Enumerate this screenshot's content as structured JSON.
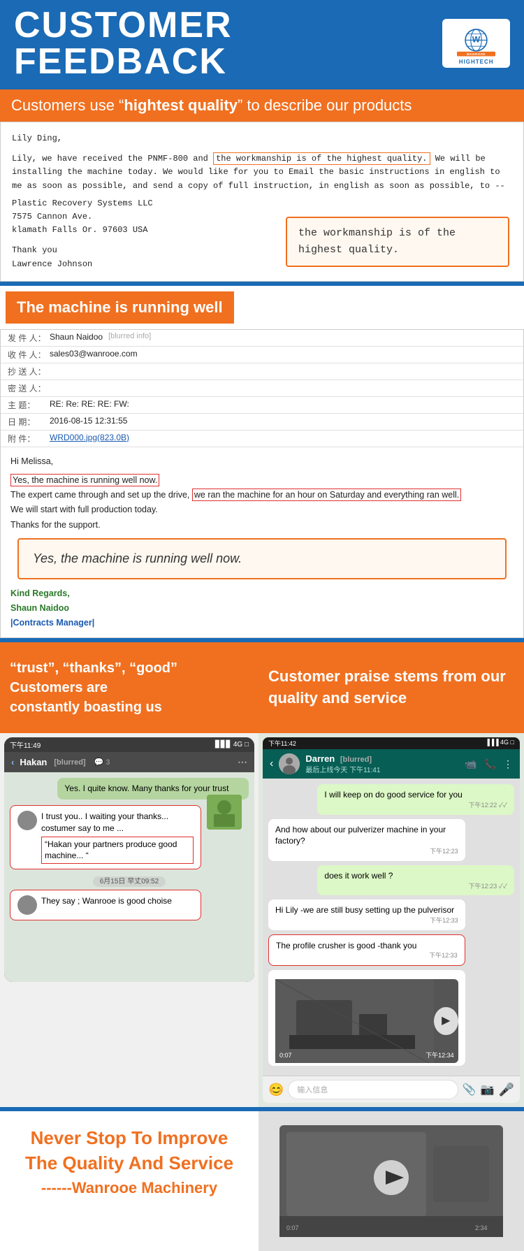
{
  "header": {
    "title": "CUSTOMER FEEDBACK",
    "logo_text_line1": "WANROOE",
    "logo_text_line2": "HIGHTECH"
  },
  "section1": {
    "banner": "Customers use “hightest quality” to describe our products",
    "banner_bold": "hightest quality",
    "email": {
      "greeting": "Lily Ding,",
      "body": "Lily, we have received the PNMF-800 and",
      "highlight": "the workmanship is of the highest quality.",
      "body2": "We will be installing the machine today.   We would like for you to Email the basic instructions in english to me as soon as possible, and send a copy of full instruction, in english as soon as possible, to --",
      "company": "Plastic Recovery Systems LLC",
      "address1": "7575 Cannon Ave.",
      "address2": "klamath Falls Or. 97603 USA",
      "closing": "Thank you",
      "signature": "Lawrence Johnson",
      "callout": "the workmanship is of the highest quality."
    }
  },
  "section2": {
    "banner": "The machine is running well",
    "email": {
      "from_label": "发 件 人：",
      "from_value": "Shaun Naidoo",
      "to_label": "收 件 人：",
      "to_value": "sales03@wanrooe.com",
      "cc_label": "抄 送 人：",
      "cc_value": "",
      "bcc_label": "密 送 人：",
      "bcc_value": "",
      "subject_label": "主    题：",
      "subject_value": "RE: Re: RE: RE: FW:",
      "date_label": "日    期：",
      "date_value": "2016-08-15 12:31:55",
      "attach_label": "附    件：",
      "attach_value": "WRD000.jpg(823.0B)",
      "greeting": "Hi Melissa,",
      "highlight1": "Yes, the machine is running well now.",
      "body1": "The expert came through and set up the drive,",
      "highlight2": "we ran the machine for an hour on Saturday and everything ran well.",
      "body2": "We will start with full production today.",
      "body3": "Thanks for the support.",
      "sign1": "Kind Regards,",
      "sign2": "Shaun Naidoo",
      "sign3": "|Contracts Manager|",
      "callout": "Yes, the machine is running well now."
    }
  },
  "section3": {
    "left_banner": "“trust”, “thanks”, “good”\nCustomers are constantly boasting us",
    "right_banner": "Customer praise stems from our quality and service",
    "left_chat": {
      "time": "下午11:49",
      "signal": "▐▐▐ 4G",
      "contact": "Hakan",
      "msg1_sent": "Yes. I quite know. Many thanks for your trust",
      "msg2_recv_prefix": "I trust you.. I waiting your thanks... costumer say to me ...",
      "msg2_recv_highlight": "“Hakan your partners produce good machine... “",
      "msg_date": "6月15日 早丈09:52",
      "msg3_recv_highlight": "They say ; Wanrooe is good choise"
    },
    "right_chat": {
      "time": "下午11:42",
      "signal": "▐▐▐ 4G",
      "contact": "Darren",
      "last_seen": "最后上线今天 下午11:41",
      "msg1_sent": "I will keep on do good service for you",
      "msg1_time": "下午12:22",
      "msg2_recv": "And how about our pulverizer machine in your factory?",
      "msg2_time": "下午12:23",
      "msg3_sent": "does it work well ?",
      "msg3_time": "下午12:23",
      "msg4_recv": "Hi Lily -we are still busy setting up the pulverisor",
      "msg4_time": "下午12:33",
      "msg5_recv_highlight": "The profile crusher is good -thank you",
      "msg5_time": "下午12:33",
      "video_time": "0:07",
      "video_msg_time": "下午12:34",
      "input_placeholder": "输入信息"
    }
  },
  "section4": {
    "title_line1": "Never Stop To Improve",
    "title_line2": "The Quality And Service",
    "title_line3": "------Wanrooe Machinery"
  }
}
